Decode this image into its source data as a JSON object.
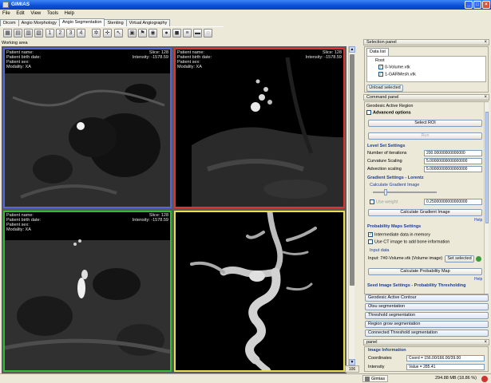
{
  "window": {
    "title": "GIMIAS"
  },
  "menu": [
    "File",
    "Edit",
    "View",
    "Tools",
    "Help"
  ],
  "tabs": [
    {
      "label": "Dicom",
      "active": false
    },
    {
      "label": "Angio Morphology",
      "active": false
    },
    {
      "label": "Angio Segmentation",
      "active": true
    },
    {
      "label": "Stenting",
      "active": false
    },
    {
      "label": "Virtual Angiography",
      "active": false
    }
  ],
  "working_area": {
    "label": "Working area"
  },
  "viewports": {
    "tl": {
      "left": [
        "Patient name:",
        "Patient birth date:",
        "Patient sex:",
        "Modality: XA"
      ],
      "right": [
        "Slice: 128",
        "Intensity: -1578.59"
      ]
    },
    "tr": {
      "left": [
        "Patient name:",
        "Patient birth date:",
        "Patient sex:",
        "Modality: XA"
      ],
      "right": [
        "Slice: 128",
        "Intensity: -1578.59"
      ]
    },
    "bl": {
      "left": [
        "Patient name:",
        "Patient birth date:",
        "Patient sex:",
        "Modality: XA"
      ],
      "right": [
        "Slice: 128",
        "Intensity: -1578.59"
      ]
    }
  },
  "zoom": "106 ET",
  "selection_panel": {
    "title": "Selection panel",
    "tab": "Data list",
    "root": "Root",
    "items": [
      "0-Volume.vtk",
      "1-GARMesh.vtk"
    ],
    "unload_label": "Unload selected"
  },
  "command_panel": {
    "title": "Command panel",
    "gac_title": "Geodesic Active Region",
    "advanced": "Advanced options",
    "select_roi": "Select ROI",
    "run": "Run",
    "level_set": {
      "title": "Level Set Settings",
      "rows": [
        {
          "label": "Number of iterations",
          "value": "200.00000000000000"
        },
        {
          "label": "Curvature Scaling",
          "value": "5.00000000000000000"
        },
        {
          "label": "Advection scaling",
          "value": "5.00000000000000000"
        }
      ]
    },
    "gradient": {
      "title": "Gradient Settings - Lorentz",
      "group": "Calculate Gradient Image",
      "use_weight": "Use weight",
      "value": "0.25000000000000000",
      "button": "Calculate Gradient Image",
      "help": "Help"
    },
    "probability": {
      "title": "Probability Maps Settings",
      "opt1": "Intermediate data in memory",
      "opt2": "Use CT image to add bone information",
      "input_group": "Input data",
      "input_text": "Input: 7#0-Volume.vtk (Volume image)",
      "set_selected": "Set selected",
      "button": "Calculate Probability Map",
      "help": "Help"
    },
    "seed": {
      "title": "Seed Image Settings - Probability Thresholding"
    }
  },
  "method_list": [
    "Geodesic Active Contour",
    "Otsu segmentation",
    "Threshold segmentation",
    "Region grow segmentation",
    "Connected Threshold segmentation"
  ],
  "info_panel": {
    "title": "panel",
    "section": "Image Information",
    "rows": [
      {
        "label": "Coordinates",
        "value": "Coord = 156.00/166.00/39.00"
      },
      {
        "label": "Intensity",
        "value": "Value = 285.41"
      }
    ]
  },
  "status": {
    "taskbar_label": "Gimias",
    "memory": "294.88 MB (18.86 %)"
  },
  "colors": {
    "border_tl": "#5566dd",
    "border_tr": "#dd3333",
    "border_bl": "#33bb33",
    "border_br": "#e8e050",
    "titlebar": "#0a4fd8"
  }
}
